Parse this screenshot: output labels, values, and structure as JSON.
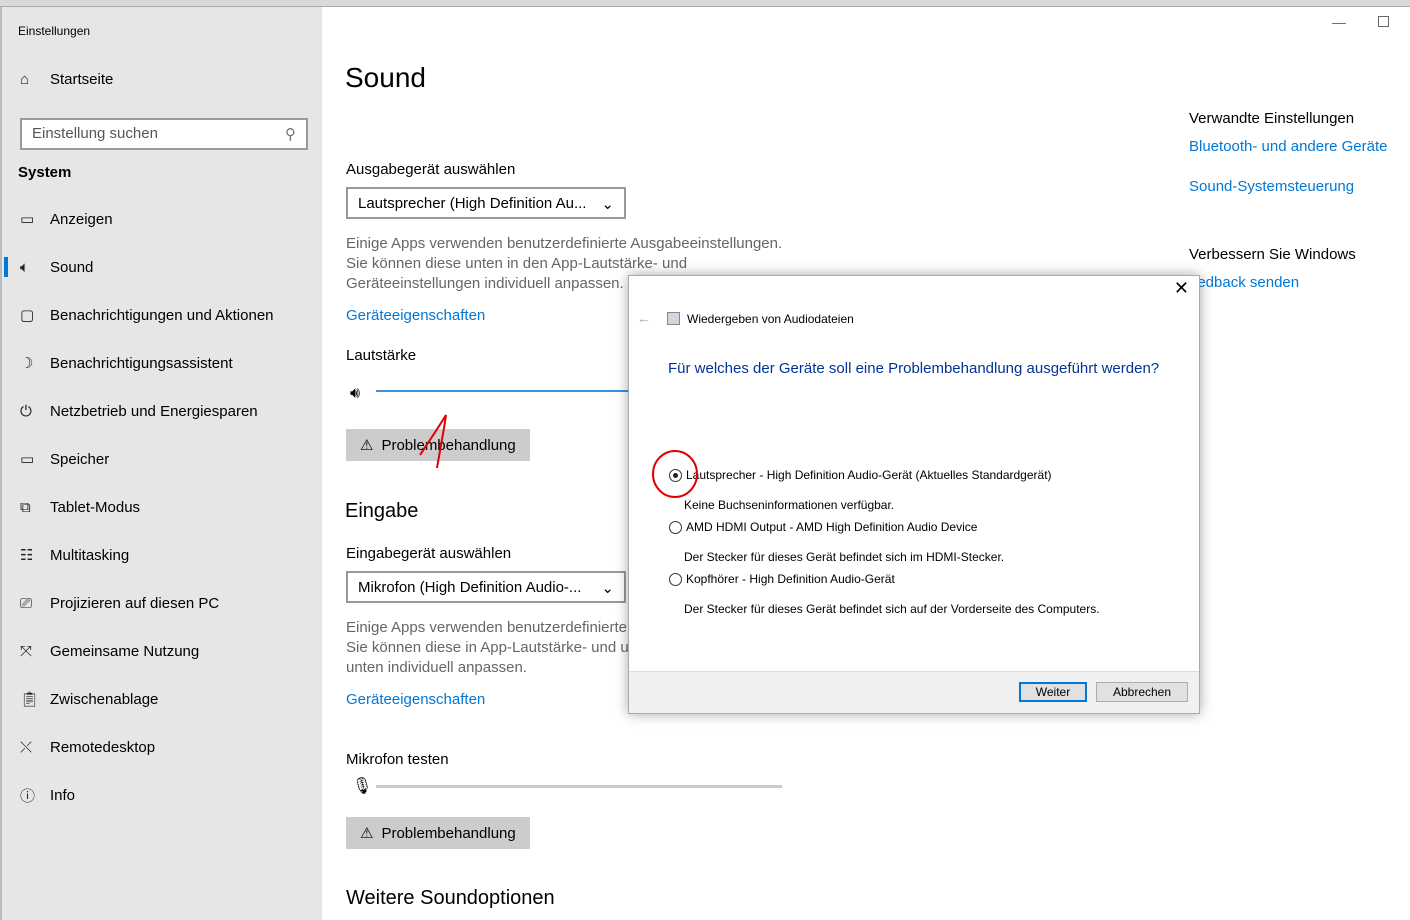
{
  "window": {
    "title": "Einstellungen",
    "minimize_icon": "minimize-icon",
    "maximize_icon": "maximize-icon"
  },
  "sidebar": {
    "home": "Startseite",
    "search_placeholder": "Einstellung suchen",
    "section": "System",
    "items": [
      {
        "label": "Anzeigen",
        "icon": "monitor-icon"
      },
      {
        "label": "Sound",
        "icon": "speaker-icon",
        "active": true
      },
      {
        "label": "Benachrichtigungen und Aktionen",
        "icon": "notification-icon"
      },
      {
        "label": "Benachrichtigungsassistent",
        "icon": "moon-icon"
      },
      {
        "label": "Netzbetrieb und Energiesparen",
        "icon": "power-icon"
      },
      {
        "label": "Speicher",
        "icon": "storage-icon"
      },
      {
        "label": "Tablet-Modus",
        "icon": "tablet-icon"
      },
      {
        "label": "Multitasking",
        "icon": "multitasking-icon"
      },
      {
        "label": "Projizieren auf diesen PC",
        "icon": "project-icon"
      },
      {
        "label": "Gemeinsame Nutzung",
        "icon": "share-icon"
      },
      {
        "label": "Zwischenablage",
        "icon": "clipboard-icon"
      },
      {
        "label": "Remotedesktop",
        "icon": "remote-icon"
      },
      {
        "label": "Info",
        "icon": "info-icon"
      }
    ]
  },
  "main": {
    "title": "Sound",
    "output": {
      "label": "Ausgabegerät auswählen",
      "selected": "Lautsprecher (High Definition Au...",
      "desc1": "Einige Apps verwenden benutzerdefinierte Ausgabeeinstellungen.",
      "desc2": "Sie können diese unten in den App-Lautstärke- und",
      "desc3": "Geräteeinstellungen individuell anpassen.",
      "link": "Geräteeigenschaften",
      "volume_label": "Lautstärke",
      "troubleshoot": "Problembehandlung"
    },
    "input": {
      "heading": "Eingabe",
      "label": "Eingabegerät auswählen",
      "selected": "Mikrofon (High Definition Audio-...",
      "desc1": "Einige Apps verwenden benutzerdefinierte",
      "desc2": "Sie können diese in App-Lautstärke- und u",
      "desc3": "unten individuell anpassen.",
      "link": "Geräteeigenschaften",
      "test_label": "Mikrofon testen",
      "troubleshoot": "Problembehandlung"
    },
    "more": "Weitere Soundoptionen"
  },
  "related": {
    "heading": "Verwandte Einstellungen",
    "links": [
      "Bluetooth- und andere Geräte",
      "Sound-Systemsteuerung"
    ],
    "improve_heading": "Verbessern Sie Windows",
    "feedback": "eedback senden"
  },
  "dialog": {
    "title": "Wiedergeben von Audiodateien",
    "question": "Für welches der Geräte soll eine Problembehandlung ausgeführt werden?",
    "options": [
      {
        "label": "Lautsprecher - High Definition Audio-Gerät (Aktuelles Standardgerät)",
        "sub": "Keine Buchseninformationen verfügbar.",
        "selected": true
      },
      {
        "label": "AMD HDMI Output - AMD High Definition Audio Device",
        "sub": "Der Stecker für dieses Gerät befindet sich im HDMI-Stecker.",
        "selected": false
      },
      {
        "label": "Kopfhörer - High Definition Audio-Gerät",
        "sub": "Der Stecker für dieses Gerät befindet sich auf der Vorderseite des Computers.",
        "selected": false
      }
    ],
    "next": "Weiter",
    "cancel": "Abbrechen"
  },
  "colors": {
    "accent": "#0078d7",
    "annotation": "#e00000"
  }
}
